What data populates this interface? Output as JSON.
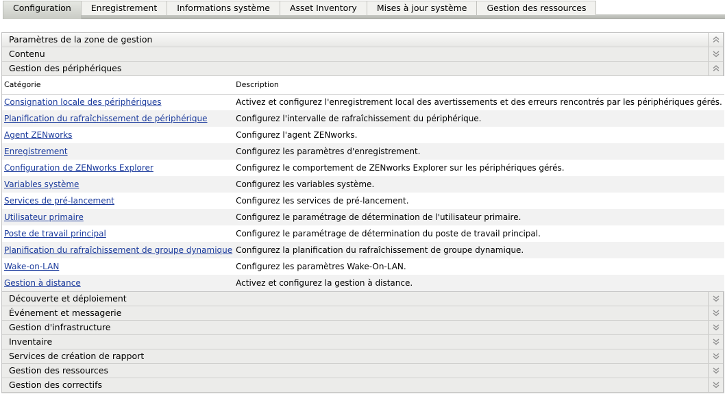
{
  "tabs": [
    {
      "label": "Configuration",
      "active": true
    },
    {
      "label": "Enregistrement",
      "active": false
    },
    {
      "label": "Informations système",
      "active": false
    },
    {
      "label": "Asset Inventory",
      "active": false
    },
    {
      "label": "Mises à jour système",
      "active": false
    },
    {
      "label": "Gestion des ressources",
      "active": false
    }
  ],
  "panel": {
    "title": "Paramètres de la zone de gestion",
    "title_toggle_icon": "collapse-icon",
    "sections_before": [
      {
        "label": "Contenu",
        "expanded": false,
        "icon": "expand-icon"
      },
      {
        "label": "Gestion des périphériques",
        "expanded": true,
        "icon": "collapse-icon"
      }
    ],
    "table": {
      "columns": [
        "Catégorie",
        "Description"
      ],
      "rows": [
        {
          "category": "Consignation locale des périphériques",
          "description": "Activez et configurez l'enregistrement local des avertissements et des erreurs rencontrés par les périphériques gérés."
        },
        {
          "category": "Planification du rafraîchissement de périphérique",
          "description": "Configurez l'intervalle de rafraîchissement du périphérique."
        },
        {
          "category": "Agent ZENworks",
          "description": "Configurez l'agent ZENworks."
        },
        {
          "category": "Enregistrement",
          "description": "Configurez les paramètres d'enregistrement."
        },
        {
          "category": "Configuration de ZENworks Explorer",
          "description": "Configurez le comportement de ZENworks Explorer sur les périphériques gérés."
        },
        {
          "category": "Variables système",
          "description": "Configurez les variables système."
        },
        {
          "category": "Services de pré-lancement",
          "description": "Configurez les services de pré-lancement."
        },
        {
          "category": "Utilisateur primaire",
          "description": "Configurez le paramétrage de détermination de l'utilisateur primaire."
        },
        {
          "category": "Poste de travail principal",
          "description": "Configurez le paramétrage de détermination du poste de travail principal."
        },
        {
          "category": "Planification du rafraîchissement de groupe dynamique",
          "description": "Configurez la planification du rafraîchissement de groupe dynamique."
        },
        {
          "category": "Wake-on-LAN",
          "description": "Configurez les paramètres Wake-On-LAN."
        },
        {
          "category": "Gestion à distance",
          "description": "Activez et configurez la gestion à distance."
        }
      ]
    },
    "sections_after": [
      {
        "label": "Découverte et déploiement",
        "expanded": false,
        "icon": "expand-icon"
      },
      {
        "label": "Événement et messagerie",
        "expanded": false,
        "icon": "expand-icon"
      },
      {
        "label": "Gestion d'infrastructure",
        "expanded": false,
        "icon": "expand-icon"
      },
      {
        "label": "Inventaire",
        "expanded": false,
        "icon": "expand-icon"
      },
      {
        "label": "Services de création de rapport",
        "expanded": false,
        "icon": "expand-icon"
      },
      {
        "label": "Gestion des ressources",
        "expanded": false,
        "icon": "expand-icon"
      },
      {
        "label": "Gestion des correctifs",
        "expanded": false,
        "icon": "expand-icon"
      }
    ]
  },
  "colors": {
    "link": "#1a3a9c",
    "header_bg": "#ececea",
    "row_alt_bg": "#f2f2f2"
  }
}
